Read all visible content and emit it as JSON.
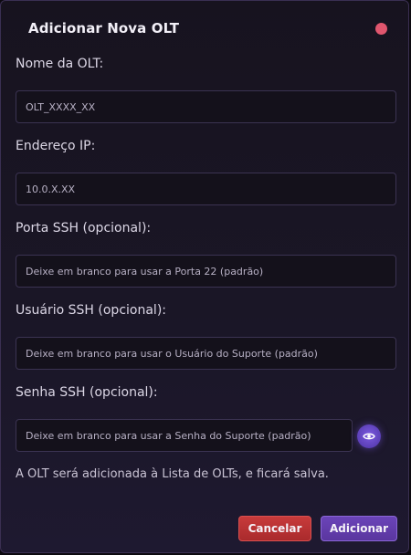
{
  "dialog": {
    "title": "Adicionar Nova OLT"
  },
  "form": {
    "name": {
      "label": "Nome da OLT:",
      "placeholder": "OLT_XXXX_XX"
    },
    "ip": {
      "label": "Endereço IP:",
      "placeholder": "10.0.X.XX"
    },
    "ssh_port": {
      "label": "Porta SSH (opcional):",
      "placeholder": "Deixe em branco para usar a Porta 22 (padrão)"
    },
    "ssh_user": {
      "label": "Usuário SSH (opcional):",
      "placeholder": "Deixe em branco para usar o Usuário do Suporte (padrão)"
    },
    "ssh_password": {
      "label": "Senha SSH (opcional):",
      "placeholder": "Deixe em branco para usar a Senha do Suporte (padrão)",
      "toggle_icon": "eye-icon"
    }
  },
  "info_text": "A OLT será adicionada à Lista de OLTs, e ficará salva.",
  "actions": {
    "cancel_label": "Cancelar",
    "add_label": "Adicionar"
  },
  "colors": {
    "close": "#e0566e",
    "cancel": "#b83236",
    "add": "#6240ad",
    "accent": "#7d5be0"
  }
}
